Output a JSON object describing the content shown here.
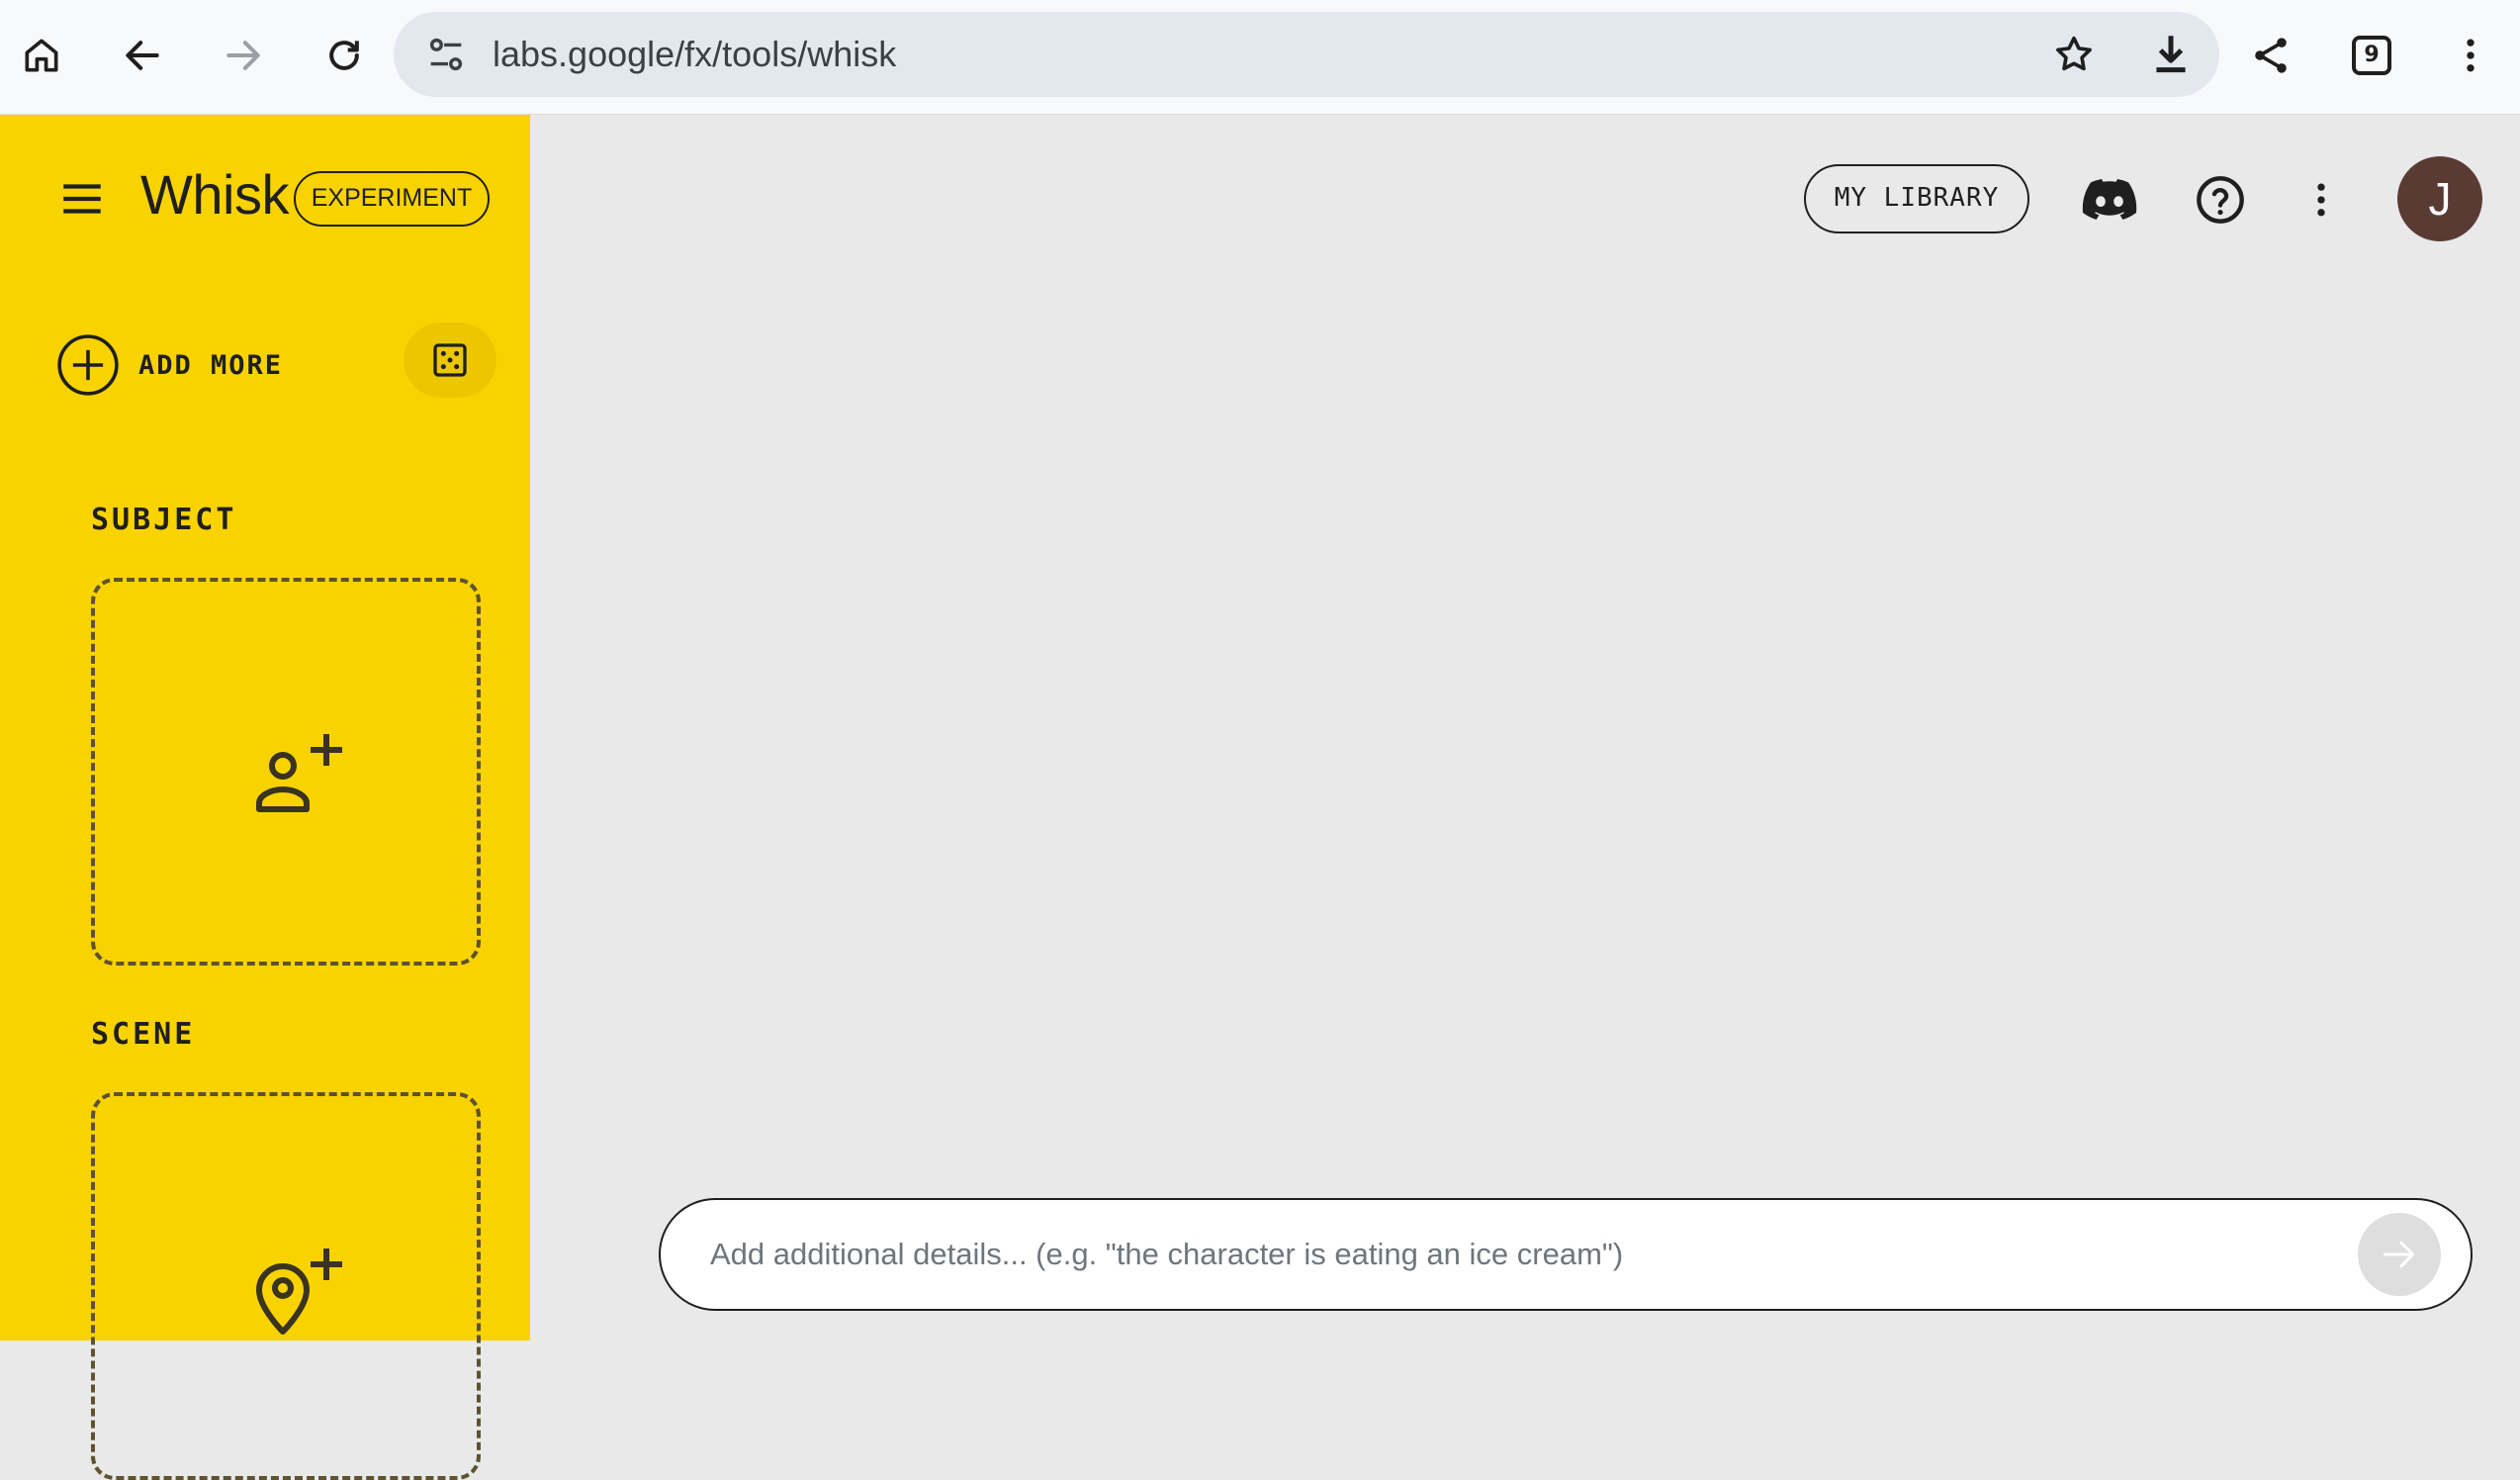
{
  "browser": {
    "url": "labs.google/fx/tools/whisk",
    "tab_count": "9"
  },
  "sidebar": {
    "brand": "Whisk",
    "badge": "EXPERIMENT",
    "add_more_label": "ADD MORE",
    "sections": [
      {
        "title": "SUBJECT",
        "icon": "person-add-icon"
      },
      {
        "title": "SCENE",
        "icon": "location-add-icon"
      }
    ]
  },
  "header": {
    "library_label": "MY LIBRARY",
    "avatar_initial": "J"
  },
  "prompt": {
    "placeholder": "Add additional details... (e.g. \"the character is eating an ice cream\")"
  },
  "colors": {
    "sidebar": "#f9d300",
    "main_bg": "#e9e9e9",
    "avatar": "#5a3b34"
  }
}
